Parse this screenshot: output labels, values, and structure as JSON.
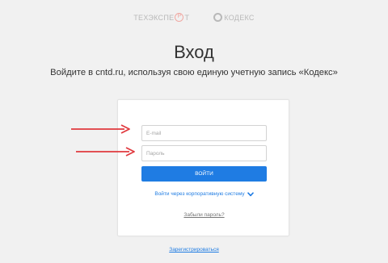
{
  "brands": {
    "first_part_1": "ТЕХЭКСПЕ",
    "first_seal": "Р",
    "first_part_2": "Т",
    "second": "КОДЕКС"
  },
  "header": {
    "title": "Вход",
    "subtitle": "Войдите в cntd.ru, используя свою единую учетную запись «Кодекс»"
  },
  "form": {
    "email_placeholder": "E-mail",
    "password_placeholder": "Пароль",
    "login_label": "ВОЙТИ",
    "corporate_link": "Войти через корпоративную систему",
    "forgot_link": "Забыли пароль?"
  },
  "footer": {
    "register_link": "Зарегистрироваться"
  },
  "colors": {
    "accent": "#1f7ce3",
    "annotation_arrow": "#e0393e",
    "background": "#f1f1f1"
  }
}
